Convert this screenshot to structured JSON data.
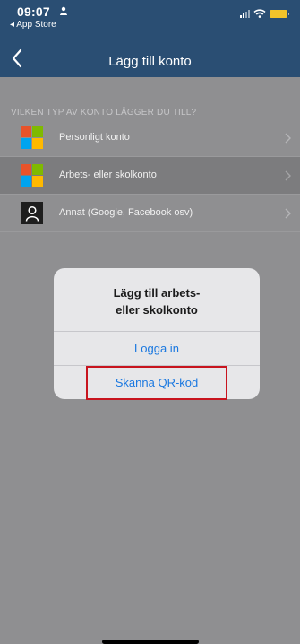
{
  "status": {
    "time": "09:07",
    "back_app": "◂ App Store",
    "person_icon": "person-icon",
    "signal_icon": "cellular-signal-icon",
    "wifi_icon": "wifi-icon",
    "battery_icon": "battery-icon",
    "battery_color": "#f3c32a"
  },
  "nav": {
    "title": "Lägg till konto",
    "back_icon": "chevron-left-icon"
  },
  "list": {
    "section_header": "VILKEN TYP AV KONTO LÄGGER DU TILL?",
    "items": [
      {
        "label": "Personligt konto",
        "icon": "microsoft-logo-icon"
      },
      {
        "label": "Arbets- eller skolkonto",
        "icon": "microsoft-logo-icon",
        "selected": true
      },
      {
        "label": "Annat (Google, Facebook osv)",
        "icon": "person-icon"
      }
    ]
  },
  "dialog": {
    "title_line1": "Lägg till arbets-",
    "title_line2": "eller skolkonto",
    "buttons": [
      "Logga in",
      "Skanna QR-kod"
    ]
  },
  "colors": {
    "nav_bg": "#2a4e73",
    "dim_bg": "#8f8f91",
    "accent_blue": "#1a78e0",
    "highlight_red": "#c8141e",
    "ms_red": "#e8532a",
    "ms_green": "#7fba00",
    "ms_blue": "#00a4ef",
    "ms_yellow": "#ffb900"
  }
}
